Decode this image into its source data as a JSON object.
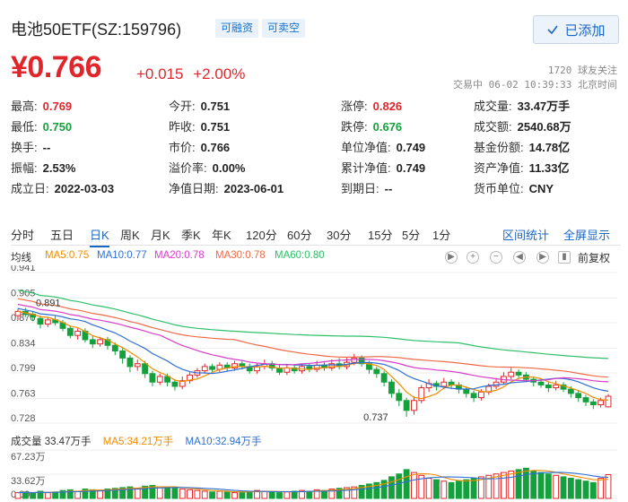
{
  "header": {
    "stock_name": "电池50ETF(SZ:159796)",
    "tag_margin": "可融资",
    "tag_short": "可卖空",
    "follow_button": "已添加"
  },
  "quote": {
    "price": "¥0.766",
    "change": "+0.015",
    "change_pct": "+2.00%",
    "follow_count": "1720 球友关注",
    "trade_status": "交易中 06-02 10:39:33 北京时间"
  },
  "stats": [
    [
      {
        "k": "最高:",
        "v": "0.769",
        "c": "red"
      },
      {
        "k": "今开:",
        "v": "0.751",
        "c": ""
      },
      {
        "k": "涨停:",
        "v": "0.826",
        "c": "red"
      },
      {
        "k": "成交量:",
        "v": "33.47万手",
        "c": ""
      }
    ],
    [
      {
        "k": "最低:",
        "v": "0.750",
        "c": "green"
      },
      {
        "k": "昨收:",
        "v": "0.751",
        "c": ""
      },
      {
        "k": "跌停:",
        "v": "0.676",
        "c": "green"
      },
      {
        "k": "成交额:",
        "v": "2540.68万",
        "c": ""
      }
    ],
    [
      {
        "k": "换手:",
        "v": "--",
        "c": ""
      },
      {
        "k": "市价:",
        "v": "0.766",
        "c": ""
      },
      {
        "k": "单位净值:",
        "v": "0.749",
        "c": ""
      },
      {
        "k": "基金份额:",
        "v": "14.78亿",
        "c": ""
      }
    ],
    [
      {
        "k": "振幅:",
        "v": "2.53%",
        "c": ""
      },
      {
        "k": "溢价率:",
        "v": "0.00%",
        "c": ""
      },
      {
        "k": "累计净值:",
        "v": "0.749",
        "c": ""
      },
      {
        "k": "资产净值:",
        "v": "11.33亿",
        "c": ""
      }
    ],
    [
      {
        "k": "成立日:",
        "v": "2022-03-03",
        "c": ""
      },
      {
        "k": "净值日期:",
        "v": "2023-06-01",
        "c": ""
      },
      {
        "k": "到期日:",
        "v": "--",
        "c": ""
      },
      {
        "k": "货币单位:",
        "v": "CNY",
        "c": ""
      }
    ]
  ],
  "tabs": [
    "分时",
    "五日",
    "日K",
    "周K",
    "月K",
    "季K",
    "年K",
    "120分",
    "60分",
    "30分",
    "15分",
    "5分",
    "1分"
  ],
  "active_tab": "日K",
  "tab_links": {
    "range_stats": "区间统计",
    "fullscreen": "全屏显示"
  },
  "ma_legend": {
    "label": "均线",
    "ma5": "MA5:0.75",
    "ma10": "MA10:0.77",
    "ma20": "MA20:0.78",
    "ma30": "MA30:0.78",
    "ma60": "MA60:0.80"
  },
  "controls": {
    "play": "▶",
    "plus": "+",
    "minus": "−",
    "left": "◀",
    "right": "▶",
    "fuquan": "前复权"
  },
  "colors": {
    "up": "#e0262b",
    "down": "#14a13d",
    "ma5": "#f08c00",
    "ma10": "#2d6fd6",
    "ma20": "#d63fc7",
    "ma30": "#ee6a4a",
    "ma60": "#2fbf6a",
    "accent": "#1a66c4"
  },
  "chart_data": {
    "type": "candlestick",
    "y_ticks": [
      "0.941",
      "0.905",
      "0.870",
      "0.834",
      "0.799",
      "0.763",
      "0.728"
    ],
    "ylim": [
      0.728,
      0.941
    ],
    "annotations": {
      "high": "0.891",
      "low": "0.737"
    },
    "candles": [
      [
        0.88,
        0.886,
        0.89,
        0.874
      ],
      [
        0.886,
        0.882,
        0.891,
        0.878
      ],
      [
        0.882,
        0.878,
        0.886,
        0.872
      ],
      [
        0.876,
        0.868,
        0.88,
        0.862
      ],
      [
        0.868,
        0.874,
        0.878,
        0.864
      ],
      [
        0.874,
        0.87,
        0.88,
        0.866
      ],
      [
        0.87,
        0.862,
        0.874,
        0.858
      ],
      [
        0.862,
        0.852,
        0.866,
        0.848
      ],
      [
        0.852,
        0.858,
        0.862,
        0.846
      ],
      [
        0.858,
        0.846,
        0.862,
        0.842
      ],
      [
        0.846,
        0.84,
        0.852,
        0.834
      ],
      [
        0.84,
        0.846,
        0.85,
        0.836
      ],
      [
        0.846,
        0.838,
        0.85,
        0.832
      ],
      [
        0.838,
        0.83,
        0.842,
        0.824
      ],
      [
        0.83,
        0.82,
        0.834,
        0.812
      ],
      [
        0.82,
        0.808,
        0.824,
        0.8
      ],
      [
        0.808,
        0.812,
        0.818,
        0.802
      ],
      [
        0.812,
        0.798,
        0.816,
        0.792
      ],
      [
        0.798,
        0.786,
        0.802,
        0.78
      ],
      [
        0.786,
        0.794,
        0.798,
        0.782
      ],
      [
        0.794,
        0.786,
        0.798,
        0.78
      ],
      [
        0.786,
        0.78,
        0.79,
        0.774
      ],
      [
        0.78,
        0.788,
        0.794,
        0.776
      ],
      [
        0.788,
        0.796,
        0.8,
        0.784
      ],
      [
        0.796,
        0.802,
        0.806,
        0.792
      ],
      [
        0.802,
        0.808,
        0.812,
        0.798
      ],
      [
        0.808,
        0.804,
        0.812,
        0.8
      ],
      [
        0.804,
        0.81,
        0.814,
        0.8
      ],
      [
        0.81,
        0.806,
        0.814,
        0.802
      ],
      [
        0.806,
        0.812,
        0.816,
        0.802
      ],
      [
        0.812,
        0.808,
        0.816,
        0.804
      ],
      [
        0.808,
        0.802,
        0.812,
        0.798
      ],
      [
        0.802,
        0.808,
        0.812,
        0.798
      ],
      [
        0.808,
        0.812,
        0.818,
        0.804
      ],
      [
        0.812,
        0.806,
        0.816,
        0.802
      ],
      [
        0.806,
        0.8,
        0.81,
        0.796
      ],
      [
        0.8,
        0.806,
        0.81,
        0.796
      ],
      [
        0.806,
        0.802,
        0.81,
        0.798
      ],
      [
        0.802,
        0.808,
        0.812,
        0.798
      ],
      [
        0.808,
        0.804,
        0.812,
        0.8
      ],
      [
        0.804,
        0.81,
        0.816,
        0.8
      ],
      [
        0.81,
        0.806,
        0.814,
        0.802
      ],
      [
        0.806,
        0.812,
        0.818,
        0.802
      ],
      [
        0.812,
        0.808,
        0.82,
        0.804
      ],
      [
        0.808,
        0.814,
        0.82,
        0.804
      ],
      [
        0.814,
        0.82,
        0.826,
        0.81
      ],
      [
        0.82,
        0.812,
        0.824,
        0.808
      ],
      [
        0.812,
        0.804,
        0.816,
        0.798
      ],
      [
        0.804,
        0.798,
        0.808,
        0.792
      ],
      [
        0.798,
        0.786,
        0.802,
        0.78
      ],
      [
        0.786,
        0.77,
        0.79,
        0.764
      ],
      [
        0.77,
        0.76,
        0.776,
        0.752
      ],
      [
        0.76,
        0.746,
        0.764,
        0.737
      ],
      [
        0.746,
        0.76,
        0.766,
        0.74
      ],
      [
        0.76,
        0.778,
        0.782,
        0.756
      ],
      [
        0.778,
        0.784,
        0.79,
        0.772
      ],
      [
        0.784,
        0.78,
        0.788,
        0.774
      ],
      [
        0.78,
        0.786,
        0.792,
        0.776
      ],
      [
        0.786,
        0.782,
        0.79,
        0.776
      ],
      [
        0.782,
        0.776,
        0.786,
        0.77
      ],
      [
        0.776,
        0.77,
        0.78,
        0.764
      ],
      [
        0.77,
        0.764,
        0.774,
        0.758
      ],
      [
        0.764,
        0.772,
        0.776,
        0.76
      ],
      [
        0.772,
        0.78,
        0.784,
        0.768
      ],
      [
        0.78,
        0.786,
        0.792,
        0.776
      ],
      [
        0.786,
        0.794,
        0.8,
        0.782
      ],
      [
        0.794,
        0.8,
        0.806,
        0.79
      ],
      [
        0.8,
        0.796,
        0.804,
        0.79
      ],
      [
        0.796,
        0.79,
        0.8,
        0.786
      ],
      [
        0.79,
        0.786,
        0.794,
        0.78
      ],
      [
        0.786,
        0.782,
        0.79,
        0.778
      ],
      [
        0.782,
        0.778,
        0.786,
        0.772
      ],
      [
        0.778,
        0.782,
        0.788,
        0.774
      ],
      [
        0.782,
        0.776,
        0.786,
        0.772
      ],
      [
        0.776,
        0.77,
        0.78,
        0.764
      ],
      [
        0.77,
        0.764,
        0.774,
        0.758
      ],
      [
        0.764,
        0.758,
        0.768,
        0.752
      ],
      [
        0.758,
        0.754,
        0.762,
        0.748
      ],
      [
        0.754,
        0.76,
        0.764,
        0.75
      ],
      [
        0.751,
        0.766,
        0.769,
        0.75
      ]
    ],
    "volume_legend": {
      "vol": "成交量 33.47万手",
      "ma5": "MA5:34.21万手",
      "ma10": "MA10:32.94万手"
    },
    "volume_ticks": [
      "67.23万",
      "33.62万",
      "0.00"
    ],
    "volume_ylim": [
      0,
      67.23
    ],
    "volumes": [
      8,
      9,
      7,
      10,
      8,
      9,
      11,
      12,
      10,
      13,
      12,
      11,
      13,
      14,
      15,
      16,
      14,
      17,
      18,
      16,
      15,
      14,
      13,
      12,
      11,
      10,
      9,
      10,
      9,
      8,
      9,
      10,
      11,
      10,
      9,
      8,
      9,
      10,
      11,
      10,
      12,
      11,
      13,
      14,
      15,
      16,
      18,
      20,
      22,
      25,
      30,
      34,
      40,
      36,
      32,
      28,
      26,
      24,
      22,
      24,
      26,
      28,
      30,
      32,
      34,
      36,
      38,
      40,
      42,
      38,
      36,
      34,
      32,
      30,
      28,
      26,
      24,
      22,
      28,
      33
    ]
  }
}
